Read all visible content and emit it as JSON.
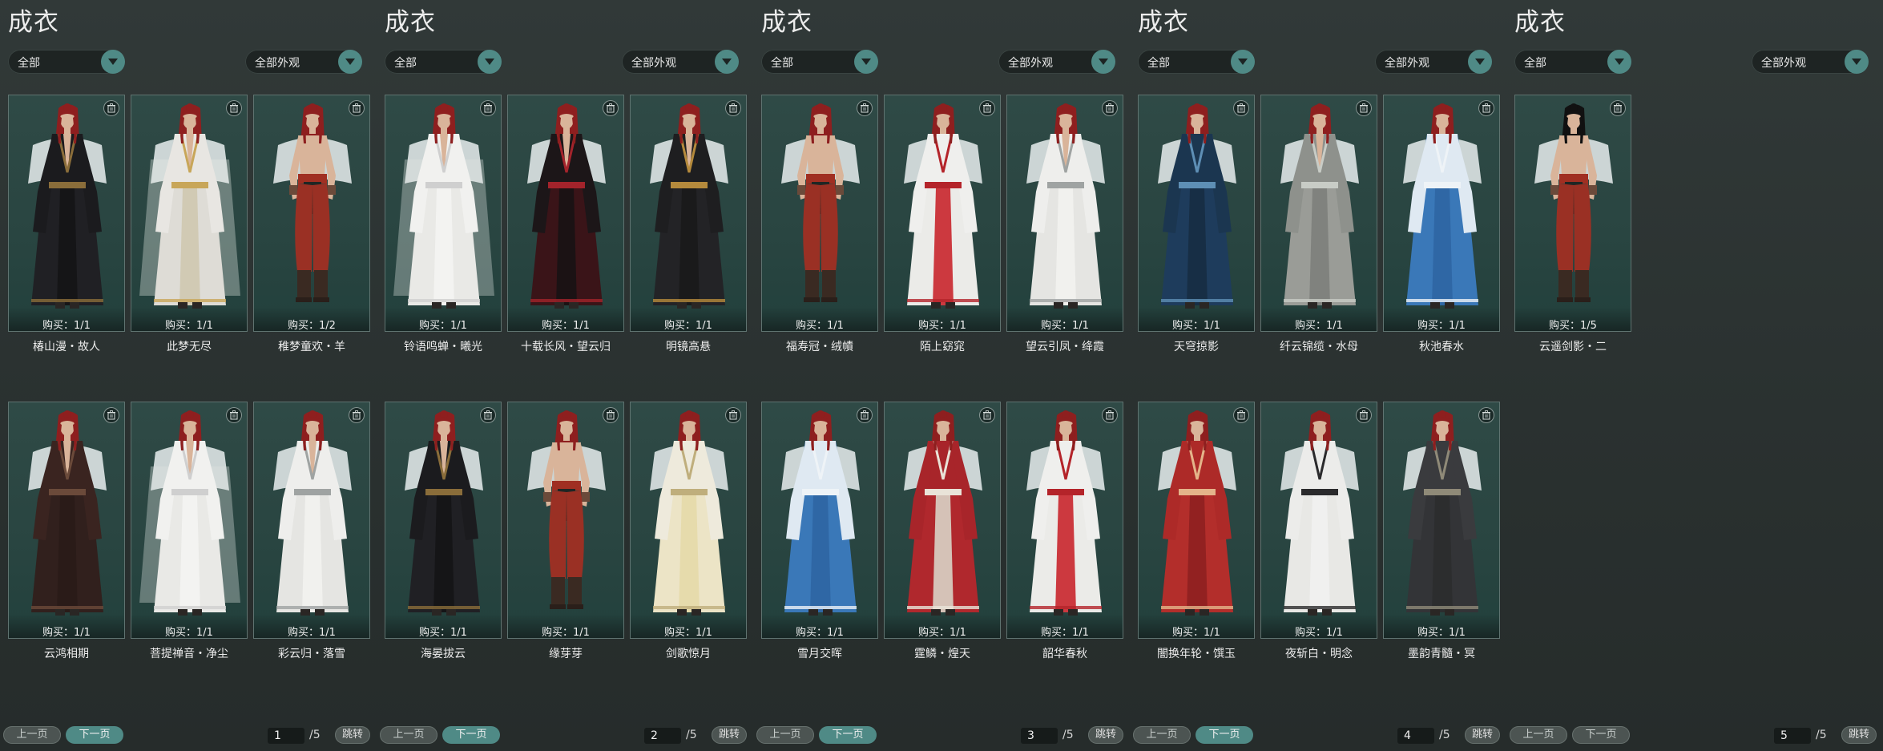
{
  "panels": [
    {
      "title": "成衣",
      "filter_left": "全部",
      "filter_right": "全部外观",
      "prev_label": "上一页",
      "next_label": "下一页",
      "page": "1",
      "total": "/5",
      "jump_label": "跳转",
      "next_active": true,
      "items": [
        {
          "name": "椿山漫・故人",
          "buy": "购买：1/1",
          "outfit": "black-robe"
        },
        {
          "name": "此梦无尽",
          "buy": "购买：1/1",
          "outfit": "white-gold-robe"
        },
        {
          "name": "稚梦童欢・羊",
          "buy": "购买：1/2",
          "outfit": "shirtless-red"
        },
        {
          "name": "云鸿相期",
          "buy": "购买：1/1",
          "outfit": "brown-robe"
        },
        {
          "name": "菩提禅音・净尘",
          "buy": "购买：1/1",
          "outfit": "white-veil-robe"
        },
        {
          "name": "彩云归・落雪",
          "buy": "购买：1/1",
          "outfit": "white-robe"
        }
      ]
    },
    {
      "title": "成衣",
      "filter_left": "全部",
      "filter_right": "全部外观",
      "prev_label": "上一页",
      "next_label": "下一页",
      "page": "2",
      "total": "/5",
      "jump_label": "跳转",
      "next_active": true,
      "items": [
        {
          "name": "铃语鸣蝉・曦光",
          "buy": "购买：1/1",
          "outfit": "white-veil-robe"
        },
        {
          "name": "十载长风・望云归",
          "buy": "购买：1/1",
          "outfit": "black-red-robe"
        },
        {
          "name": "明镜高悬",
          "buy": "购买：1/1",
          "outfit": "black-gold-robe"
        },
        {
          "name": "海晏拔云",
          "buy": "购买：1/1",
          "outfit": "black-robe"
        },
        {
          "name": "缘芽芽",
          "buy": "购买：1/1",
          "outfit": "shirtless-red"
        },
        {
          "name": "剑歌惊月",
          "buy": "购买：1/1",
          "outfit": "cream-robe"
        }
      ]
    },
    {
      "title": "成衣",
      "filter_left": "全部",
      "filter_right": "全部外观",
      "prev_label": "上一页",
      "next_label": "下一页",
      "page": "3",
      "total": "/5",
      "jump_label": "跳转",
      "next_active": true,
      "items": [
        {
          "name": "福寿冠・绒幘",
          "buy": "购买：1/1",
          "outfit": "shirtless-red"
        },
        {
          "name": "陌上窈窕",
          "buy": "购买：1/1",
          "outfit": "white-red-robe"
        },
        {
          "name": "望云引凤・绛霞",
          "buy": "购买：1/1",
          "outfit": "white-robe"
        },
        {
          "name": "雪月交晖",
          "buy": "购买：1/1",
          "outfit": "blue-white-robe"
        },
        {
          "name": "霆鳞・煌天",
          "buy": "购买：1/1",
          "outfit": "red-white-robe"
        },
        {
          "name": "韶华春秋",
          "buy": "购买：1/1",
          "outfit": "white-red-robe"
        }
      ]
    },
    {
      "title": "成衣",
      "filter_left": "全部",
      "filter_right": "全部外观",
      "prev_label": "上一页",
      "next_label": "下一页",
      "page": "4",
      "total": "/5",
      "jump_label": "跳转",
      "next_active": true,
      "items": [
        {
          "name": "天穹掠影",
          "buy": "购买：1/1",
          "outfit": "navy-robe"
        },
        {
          "name": "纤云锦缆・水母",
          "buy": "购买：1/1",
          "outfit": "grey-robe"
        },
        {
          "name": "秋池春水",
          "buy": "购买：1/1",
          "outfit": "blue-white-robe"
        },
        {
          "name": "闇换年轮・馔玉",
          "buy": "购买：1/1",
          "outfit": "red-robe"
        },
        {
          "name": "夜斩白・明念",
          "buy": "购买：1/1",
          "outfit": "white-black-robe"
        },
        {
          "name": "墨韵青髓・冥",
          "buy": "购买：1/1",
          "outfit": "dark-grey-robe"
        }
      ]
    },
    {
      "title": "成衣",
      "filter_left": "全部",
      "filter_right": "全部外观",
      "prev_label": "上一页",
      "next_label": "下一页",
      "page": "5",
      "total": "/5",
      "jump_label": "跳转",
      "next_active": false,
      "items": [
        {
          "name": "云遥剑影・二",
          "buy": "购买：1/5",
          "outfit": "shirtless-red-blackhair"
        }
      ]
    }
  ],
  "colors": {
    "accent": "#4f8a86",
    "card_bg": "#2f4a46",
    "card_border": "#5f7370",
    "panel_bg": "#2b3332",
    "hair": "#8e1f1f"
  }
}
